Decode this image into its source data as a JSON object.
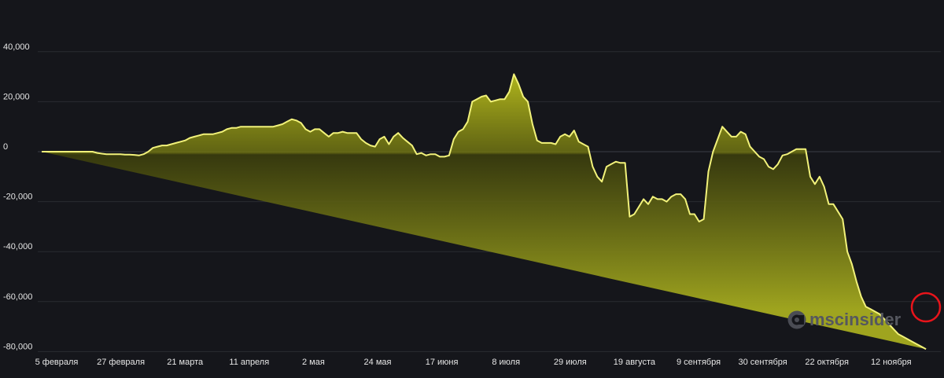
{
  "chart_data": {
    "type": "area",
    "title": "",
    "xlabel": "",
    "ylabel": "",
    "ylim": [
      -80000,
      40000
    ],
    "y_ticks": [
      40000,
      20000,
      0,
      -20000,
      -40000,
      -60000,
      -80000
    ],
    "y_tick_labels": [
      "40,000",
      "20,000",
      "0",
      "-20,000",
      "-40,000",
      "-60,000",
      "-80,000"
    ],
    "x_tick_labels": [
      "5 февраля",
      "27 февраля",
      "21 марта",
      "11 апреля",
      "2 мая",
      "24 мая",
      "17 июня",
      "8 июля",
      "29 июля",
      "19 августа",
      "9 сентября",
      "30 сентября",
      "22 октября",
      "12 ноября"
    ],
    "grid": true,
    "line_color": "#f2f27a",
    "fill_color": "#8a8f17",
    "background": "#15161b",
    "highlight": {
      "color": "#e8141b",
      "shape": "circle",
      "target": "last-point"
    },
    "series": [
      {
        "x_index": [
          0,
          1,
          2,
          3,
          4,
          5,
          6,
          7,
          8,
          9,
          10,
          11,
          12,
          13,
          14,
          15,
          16,
          17,
          18,
          19,
          20,
          21,
          22,
          23,
          24,
          25,
          26,
          27,
          28,
          29,
          30,
          31,
          32,
          33,
          34,
          35,
          36,
          37,
          38,
          39,
          40,
          41,
          42,
          43,
          44,
          45,
          46,
          47,
          48,
          49,
          50,
          51,
          52,
          53,
          54,
          55,
          56,
          57,
          58,
          59,
          60,
          61,
          62,
          63,
          64,
          65,
          66,
          67,
          68,
          69,
          70,
          71,
          72,
          73,
          74,
          75,
          76,
          77,
          78,
          79,
          80,
          81,
          82,
          83,
          84,
          85,
          86,
          87,
          88,
          89,
          90,
          91,
          92,
          93,
          94,
          95,
          96,
          97,
          98,
          99,
          100,
          101,
          102,
          103,
          104,
          105,
          106,
          107,
          108,
          109,
          110,
          111,
          112,
          113,
          114,
          115,
          116,
          117,
          118,
          119,
          120,
          121,
          122,
          123,
          124,
          125,
          126,
          127,
          128,
          129,
          130,
          131,
          132,
          133,
          134,
          135,
          136,
          137,
          138,
          139,
          140,
          141,
          142,
          143,
          144,
          145,
          146,
          147,
          148,
          149,
          150,
          151,
          152,
          153,
          154,
          155,
          156,
          157,
          158,
          159,
          160,
          161,
          162,
          163,
          164,
          165,
          166,
          167,
          168,
          169,
          170,
          171,
          172,
          173,
          174,
          175,
          176,
          177,
          178,
          179,
          180,
          181,
          182,
          183,
          184,
          185,
          186,
          187,
          188,
          189,
          190,
          191
        ],
        "values": [
          0,
          0,
          0,
          0,
          0,
          0,
          0,
          0,
          0,
          0,
          0,
          0,
          -500,
          -800,
          -1000,
          -1000,
          -1000,
          -1000,
          -1200,
          -1200,
          -1300,
          -1500,
          -1000,
          0,
          1500,
          2000,
          2500,
          2500,
          3000,
          3500,
          4000,
          4500,
          5500,
          6000,
          6500,
          7000,
          7000,
          7000,
          7500,
          8000,
          9000,
          9500,
          9500,
          10000,
          10000,
          10000,
          10000,
          10000,
          10000,
          10000,
          10000,
          10500,
          11000,
          12000,
          13000,
          12500,
          11500,
          9000,
          8000,
          9000,
          9000,
          7500,
          6000,
          7500,
          7500,
          8000,
          7500,
          7500,
          7500,
          5000,
          3500,
          2500,
          2000,
          5000,
          6000,
          3000,
          6000,
          7500,
          5500,
          4000,
          2500,
          -1000,
          -500,
          -1500,
          -1000,
          -1000,
          -2000,
          -2000,
          -1500,
          5000,
          8000,
          9000,
          12000,
          20000,
          21000,
          22000,
          22500,
          20000,
          20500,
          21000,
          21000,
          24000,
          31000,
          27000,
          22000,
          20000,
          11000,
          4500,
          3500,
          3500,
          3500,
          3000,
          6000,
          7000,
          6000,
          8500,
          4000,
          3000,
          2000,
          -6000,
          -10000,
          -12000,
          -6000,
          -5000,
          -4000,
          -4500,
          -4500,
          -26000,
          -25000,
          -22000,
          -19000,
          -21000,
          -18000,
          -19000,
          -19000,
          -20000,
          -18000,
          -17000,
          -17000,
          -19000,
          -25000,
          -25000,
          -28000,
          -27000,
          -8000,
          0,
          5000,
          10000,
          8000,
          6000,
          6000,
          8000,
          7000,
          2000,
          0,
          -2000,
          -3000,
          -6000,
          -7000,
          -5000,
          -1500,
          -1000,
          0,
          1000,
          1000,
          1000,
          -10000,
          -13000,
          -10000,
          -14000,
          -21000,
          -21000,
          -24000,
          -27000,
          -40000,
          -45000,
          -52000,
          -58000,
          -62000,
          -63000,
          -64000,
          -65000,
          -67000,
          -69000,
          -71000,
          -73000,
          -74000,
          -75000,
          -76000,
          -77000,
          -78000,
          -79000,
          -79500
        ]
      }
    ]
  },
  "watermark": {
    "text": "mscinsider",
    "icon": "msc-logo-icon"
  }
}
